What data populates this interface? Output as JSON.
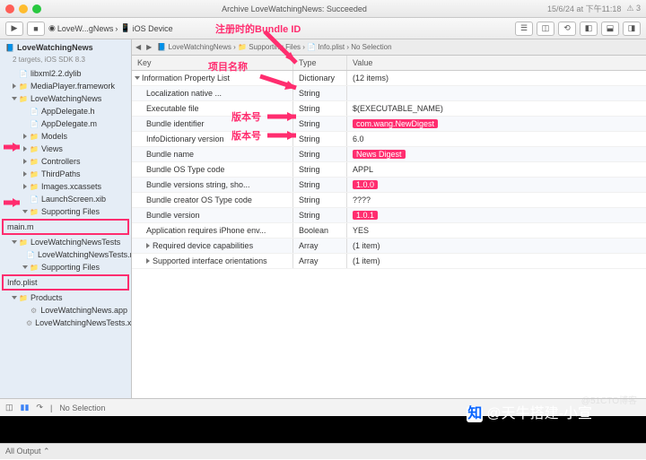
{
  "titlebar": {
    "center": "Archive LoveWatchingNews: Succeeded",
    "date": "15/6/24 at 下午11:18",
    "warn": "⚠ 3"
  },
  "toolbar": {
    "scheme": "LoveW...gNews",
    "device": "iOS Device"
  },
  "breadcrumbs": [
    "LoveWatchingNews",
    "Supporting Files",
    "Info.plist",
    "No Selection"
  ],
  "sidebar": {
    "project": "LoveWatchingNews",
    "subtitle": "2 targets, iOS SDK 8.3",
    "items": [
      {
        "l": 1,
        "icon": "file-h",
        "label": "libxml2.2.dylib"
      },
      {
        "l": 1,
        "icon": "folder",
        "label": "MediaPlayer.framework",
        "disc": "closed"
      },
      {
        "l": 1,
        "icon": "folder",
        "label": "LoveWatchingNews",
        "disc": "open"
      },
      {
        "l": 2,
        "icon": "file-h",
        "label": "AppDelegate.h"
      },
      {
        "l": 2,
        "icon": "file-m",
        "label": "AppDelegate.m"
      },
      {
        "l": 2,
        "icon": "folder",
        "label": "Models",
        "disc": "closed"
      },
      {
        "l": 2,
        "icon": "folder",
        "label": "Views",
        "disc": "closed"
      },
      {
        "l": 2,
        "icon": "folder",
        "label": "Controllers",
        "disc": "closed"
      },
      {
        "l": 2,
        "icon": "folder",
        "label": "ThirdPaths",
        "disc": "closed"
      },
      {
        "l": 2,
        "icon": "folder",
        "label": "Images.xcassets",
        "disc": "closed"
      },
      {
        "l": 2,
        "icon": "file-m",
        "label": "LaunchScreen.xib"
      },
      {
        "l": 2,
        "icon": "folder",
        "label": "Supporting Files",
        "disc": "open"
      }
    ],
    "box1": "main.m",
    "items2": [
      {
        "l": 1,
        "icon": "folder",
        "label": "LoveWatchingNewsTests",
        "disc": "open"
      },
      {
        "l": 2,
        "icon": "file-m",
        "label": "LoveWatchingNewsTests.m"
      },
      {
        "l": 2,
        "icon": "folder",
        "label": "Supporting Files",
        "disc": "open"
      }
    ],
    "box2": "Info.plist",
    "items3": [
      {
        "l": 1,
        "icon": "folder",
        "label": "Products",
        "disc": "open"
      },
      {
        "l": 2,
        "icon": "file-plist",
        "label": "LoveWatchingNews.app"
      },
      {
        "l": 2,
        "icon": "file-plist",
        "label": "LoveWatchingNewsTests.xctest"
      }
    ]
  },
  "plist": {
    "headers": {
      "key": "Key",
      "type": "Type",
      "value": "Value"
    },
    "rows": [
      {
        "key": "Information Property List",
        "type": "Dictionary",
        "value": "(12 items)",
        "disc": "open"
      },
      {
        "key": "Localization native ...",
        "type": "String",
        "value": ""
      },
      {
        "key": "Executable file",
        "type": "String",
        "value": "$(EXECUTABLE_NAME)"
      },
      {
        "key": "Bundle identifier",
        "type": "String",
        "value": "com.wang.NewDigest",
        "hilite": true
      },
      {
        "key": "InfoDictionary version",
        "type": "String",
        "value": "6.0"
      },
      {
        "key": "Bundle name",
        "type": "String",
        "value": "News Digest",
        "hilite": true
      },
      {
        "key": "Bundle OS Type code",
        "type": "String",
        "value": "APPL"
      },
      {
        "key": "Bundle versions string, sho...",
        "type": "String",
        "value": "1.0.0",
        "hilite": true
      },
      {
        "key": "Bundle creator OS Type code",
        "type": "String",
        "value": "????"
      },
      {
        "key": "Bundle version",
        "type": "String",
        "value": "1.0.1",
        "hilite": true
      },
      {
        "key": "Application requires iPhone env...",
        "type": "Boolean",
        "value": "YES"
      },
      {
        "key": "Required device capabilities",
        "type": "Array",
        "value": "(1 item)",
        "disc": "closed"
      },
      {
        "key": "Supported interface orientations",
        "type": "Array",
        "value": "(1 item)",
        "disc": "closed"
      }
    ]
  },
  "annotations": {
    "bundleId": "注册时的Bundle ID",
    "projName": "项目名称",
    "ver1": "版本号",
    "ver2": "版本号"
  },
  "debug": {
    "noSelection": "No Selection"
  },
  "bottom": {
    "allOutput": "All Output ⌃"
  },
  "watermark": "@天牛搭建-小宣",
  "watermark2": "@51CTO博客",
  "zhi": "知"
}
